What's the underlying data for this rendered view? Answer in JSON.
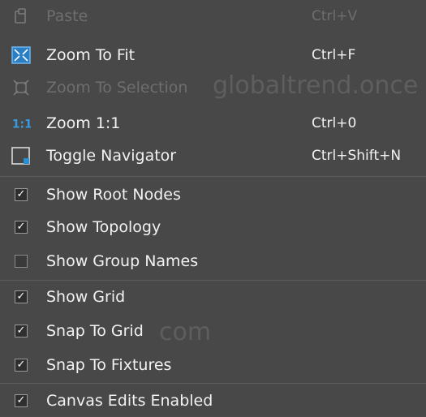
{
  "menu": {
    "items": [
      {
        "label": "Paste",
        "shortcut": "Ctrl+V",
        "icon": "paste-icon",
        "enabled": false
      },
      {
        "label": "Zoom To Fit",
        "shortcut": "Ctrl+F",
        "icon": "zoom-to-fit-icon",
        "enabled": true
      },
      {
        "label": "Zoom To Selection",
        "shortcut": "",
        "icon": "zoom-to-selection-icon",
        "enabled": false
      },
      {
        "label": "Zoom 1:1",
        "shortcut": "Ctrl+0",
        "icon": "zoom-1-1-icon",
        "enabled": true
      },
      {
        "label": "Toggle Navigator",
        "shortcut": "Ctrl+Shift+N",
        "icon": "navigator-icon",
        "enabled": true
      },
      {
        "label": "Show Root Nodes",
        "checked": true
      },
      {
        "label": "Show Topology",
        "checked": true
      },
      {
        "label": "Show Group Names",
        "checked": false
      },
      {
        "label": "Show Grid",
        "checked": true
      },
      {
        "label": "Snap To Grid",
        "checked": true
      },
      {
        "label": "Snap To Fixtures",
        "checked": true
      },
      {
        "label": "Canvas Edits Enabled",
        "checked": true
      }
    ]
  },
  "watermark": {
    "text1": "globaltrend.once",
    "text2": "com"
  },
  "colors": {
    "background": "#484848",
    "text": "#f2f2f2",
    "disabled_text": "#6e6e6e",
    "accent_blue": "#2a8fd6"
  }
}
